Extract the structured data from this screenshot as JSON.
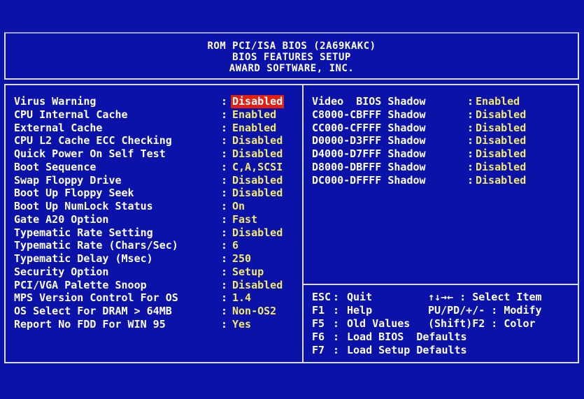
{
  "header": {
    "line1": "ROM PCI/ISA BIOS (2A69KAKC)",
    "line2": "BIOS FEATURES SETUP",
    "line3": "AWARD SOFTWARE, INC."
  },
  "settings": [
    {
      "label": "Virus Warning",
      "value": "Disabled",
      "selected": true
    },
    {
      "label": "CPU Internal Cache",
      "value": "Enabled"
    },
    {
      "label": "External Cache",
      "value": "Enabled"
    },
    {
      "label": "CPU L2 Cache ECC Checking",
      "value": "Disabled"
    },
    {
      "label": "Quick Power On Self Test",
      "value": "Disabled"
    },
    {
      "label": "Boot Sequence",
      "value": "C,A,SCSI"
    },
    {
      "label": "Swap Floppy Drive",
      "value": "Disabled"
    },
    {
      "label": "Boot Up Floppy Seek",
      "value": "Disabled"
    },
    {
      "label": "Boot Up NumLock Status",
      "value": "On"
    },
    {
      "label": "Gate A20 Option",
      "value": "Fast"
    },
    {
      "label": "Typematic Rate Setting",
      "value": "Disabled"
    },
    {
      "label": "Typematic Rate (Chars/Sec)",
      "value": "6"
    },
    {
      "label": "Typematic Delay (Msec)",
      "value": "250"
    },
    {
      "label": "Security Option",
      "value": "Setup"
    },
    {
      "label": "PCI/VGA Palette Snoop",
      "value": "Disabled"
    },
    {
      "label": "MPS Version Control For OS",
      "value": "1.4"
    },
    {
      "label": "OS Select For DRAM > 64MB",
      "value": "Non-OS2"
    },
    {
      "label": "Report No FDD For WIN 95",
      "value": "Yes"
    }
  ],
  "shadow": [
    {
      "label": "Video  BIOS Shadow",
      "value": "Enabled"
    },
    {
      "label": "C8000-CBFFF Shadow",
      "value": "Disabled"
    },
    {
      "label": "CC000-CFFFF Shadow",
      "value": "Disabled"
    },
    {
      "label": "D0000-D3FFF Shadow",
      "value": "Disabled"
    },
    {
      "label": "D4000-D7FFF Shadow",
      "value": "Disabled"
    },
    {
      "label": "D8000-DBFFF Shadow",
      "value": "Disabled"
    },
    {
      "label": "DC000-DFFFF Shadow",
      "value": "Disabled"
    }
  ],
  "keys": [
    {
      "key": "ESC",
      "desc": "Quit",
      "hint": "↑↓→← : Select Item"
    },
    {
      "key": "F1",
      "desc": "Help",
      "hint": "PU/PD/+/- : Modify"
    },
    {
      "key": "F5",
      "desc": "Old Values",
      "hint": "(Shift)F2 : Color"
    },
    {
      "key": "F6",
      "desc": "Load BIOS  Defaults",
      "hint": ""
    },
    {
      "key": "F7",
      "desc": "Load Setup Defaults",
      "hint": ""
    }
  ],
  "colors": {
    "background": "#0a12a8",
    "value": "#f3e96a",
    "highlight": "#e02010"
  }
}
